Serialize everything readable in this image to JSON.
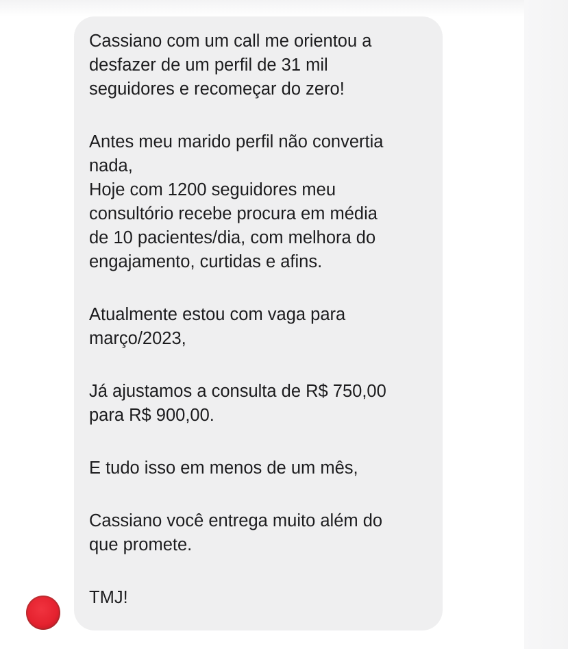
{
  "message": {
    "paragraphs": [
      "Cassiano com um call me orientou a\ndesfazer de um perfil de 31 mil\nseguidores e recomeçar do zero!",
      "Antes meu marido perfil não convertia\nnada,\nHoje com 1200 seguidores meu\nconsultório recebe procura em média\nde 10 pacientes/dia, com melhora do\nengajamento, curtidas e afins.",
      "Atualmente estou com vaga para\nmarço/2023,",
      "Já ajustamos a consulta de R$ 750,00\npara R$ 900,00.",
      "E tudo isso em menos de um mês,",
      "Cassiano você entrega muito além do\nque promete.",
      "TMJ!"
    ]
  },
  "avatar": {
    "icon": "avatar-redacted",
    "color": "#e5222f"
  },
  "colors": {
    "bubble": "#efeff0",
    "text": "#1c1c1e",
    "background": "#ffffff"
  }
}
